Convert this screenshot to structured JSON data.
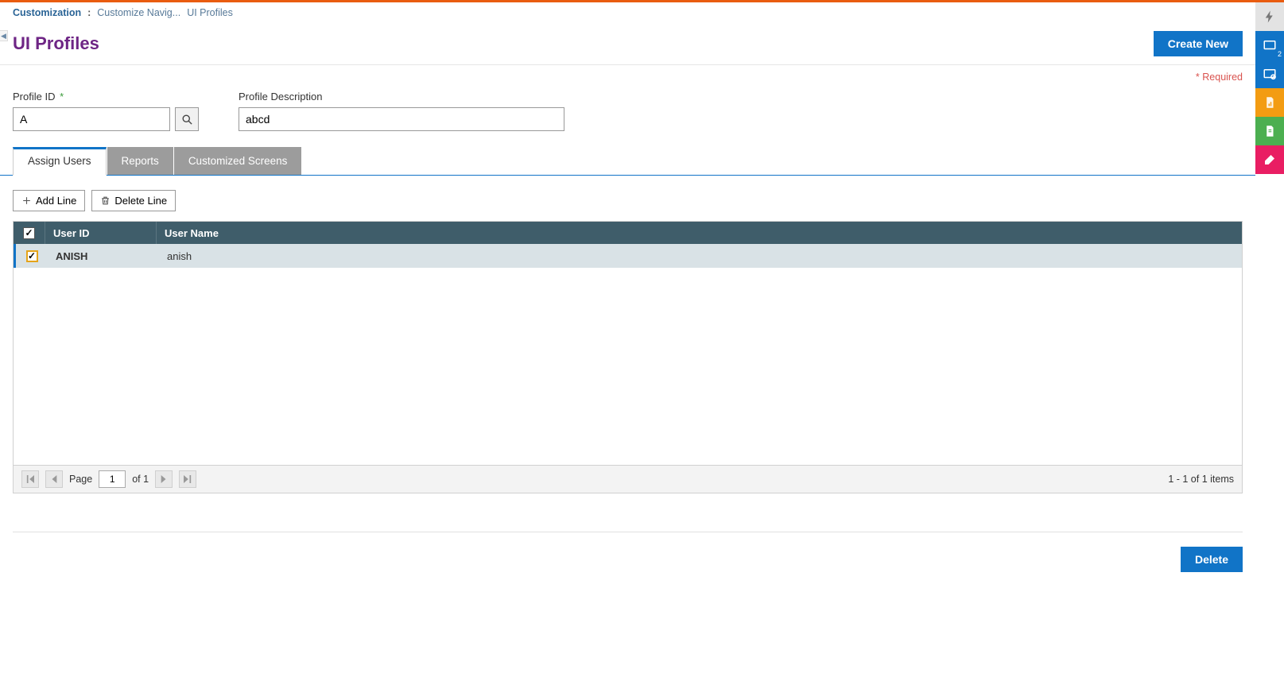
{
  "breadcrumb": {
    "root": "Customization",
    "sep": ":",
    "nav": "Customize Navig...",
    "current": "UI Profiles"
  },
  "page_title": "UI Profiles",
  "create_new_label": "Create New",
  "required_label": "* Required",
  "form": {
    "profile_id_label": "Profile ID",
    "profile_id_value": "A",
    "profile_desc_label": "Profile Description",
    "profile_desc_value": "abcd"
  },
  "tabs": [
    {
      "label": "Assign Users",
      "active": true
    },
    {
      "label": "Reports",
      "active": false
    },
    {
      "label": "Customized Screens",
      "active": false
    }
  ],
  "grid_toolbar": {
    "add_line": "Add Line",
    "delete_line": "Delete Line"
  },
  "grid": {
    "columns": {
      "user_id": "User ID",
      "user_name": "User Name"
    },
    "rows": [
      {
        "user_id": "ANISH",
        "user_name": "anish",
        "checked": true
      }
    ]
  },
  "pager": {
    "page_label": "Page",
    "page_value": "1",
    "of_label": "of 1",
    "items_label": "1 - 1 of 1 items"
  },
  "footer": {
    "delete_label": "Delete"
  },
  "side": {
    "badge": "2"
  }
}
